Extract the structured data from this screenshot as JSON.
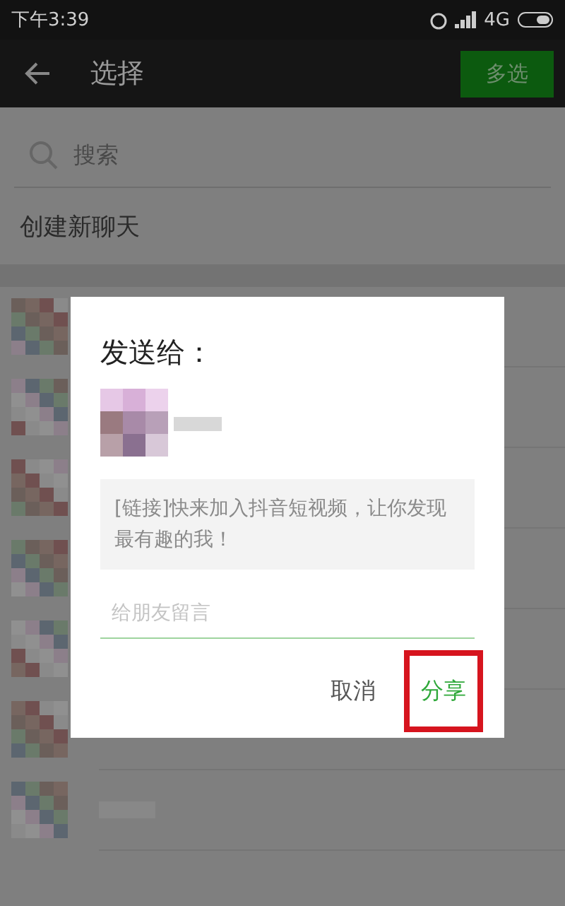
{
  "status_bar": {
    "time": "下午3:39",
    "network": "4G"
  },
  "header": {
    "title": "选择",
    "action": "多选"
  },
  "search": {
    "placeholder": "搜索"
  },
  "new_chat": "创建新聊天",
  "dialog": {
    "title": "发送给：",
    "message": "[链接]快来加入抖音短视频，让你发现最有趣的我！",
    "input": {
      "placeholder": "给朋友留言"
    },
    "buttons": [
      {
        "label": "取消",
        "kind": "cancel",
        "highlighted": false
      },
      {
        "label": "分享",
        "kind": "primary",
        "highlighted": true
      }
    ]
  }
}
